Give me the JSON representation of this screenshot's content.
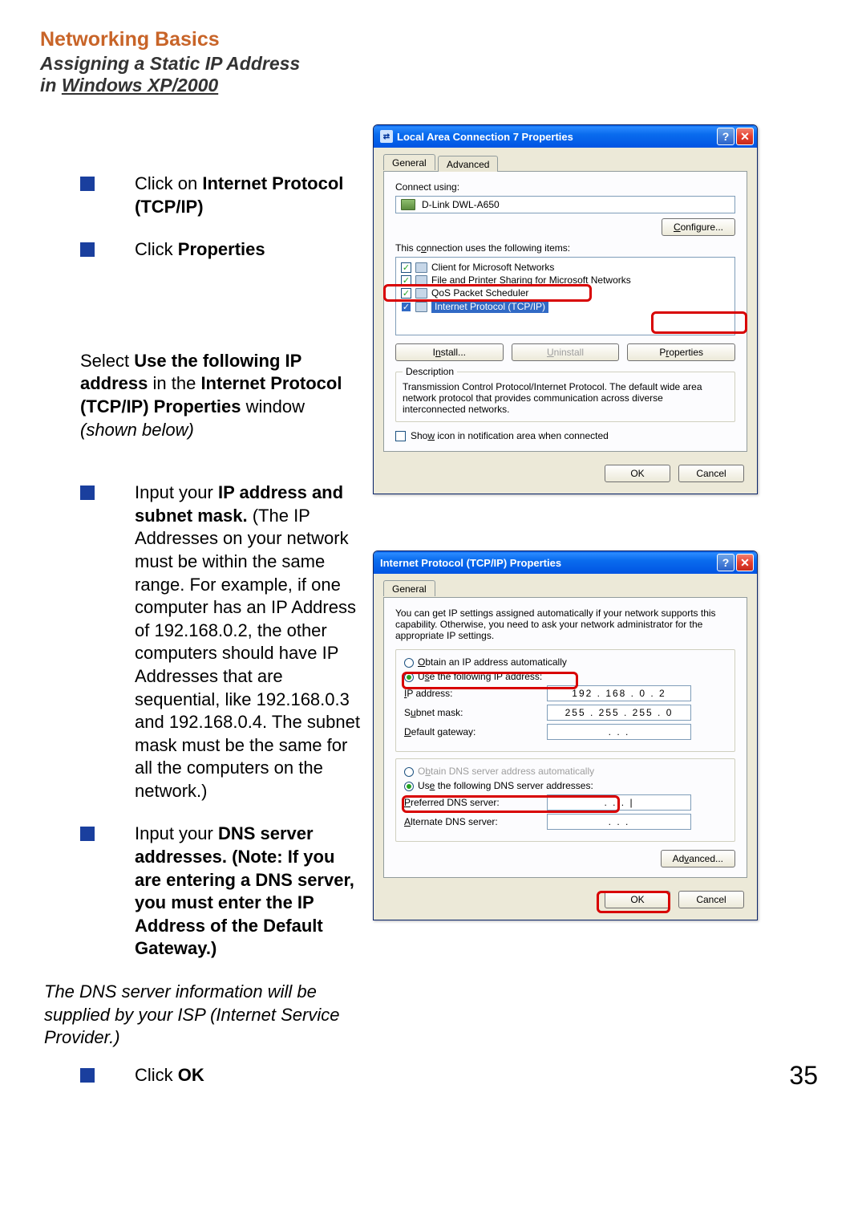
{
  "heading": "Networking Basics",
  "subtitle_line1": "Assigning a Static IP Address",
  "subtitle_line2_prefix": "in ",
  "subtitle_line2_u": "Windows XP/2000",
  "bullets": {
    "b1_pre": "Click on ",
    "b1_bold": "Internet Protocol (TCP/IP)",
    "b2_pre": "Click ",
    "b2_bold": "Properties",
    "select_text_pre": "Select ",
    "select_text_b1": "Use the following IP address",
    "select_text_mid": "  in the ",
    "select_text_b2": "Internet Protocol (TCP/IP) Properties",
    "select_text_post1": " window ",
    "select_text_post2": "(shown below)",
    "b3_pre": "Input your ",
    "b3_bold": "IP address and subnet mask.",
    "b3_rest": " (The IP Addresses on your network must be within the same range. For example, if one computer has an IP Address of 192.168.0.2, the other computers should have IP Addresses that are sequential, like 192.168.0.3 and 192.168.0.4.  The subnet mask must be the same for all the computers on the network.)",
    "b4_pre": "Input your ",
    "b4_bold": "DNS server addresses.  (Note:  If you are entering a DNS server, you must enter the IP Address of the Default Gateway.)",
    "dns_note": "The DNS server information will be supplied by your ISP (Internet Service Provider.)",
    "b5_pre": "Click ",
    "b5_bold": "OK"
  },
  "page_number": "35",
  "dialog1": {
    "title": "Local Area Connection 7 Properties",
    "tab_general": "General",
    "tab_advanced": "Advanced",
    "connect_using": "Connect using:",
    "device": "D-Link DWL-A650",
    "configure": "Configure...",
    "uses_items": "This connection uses the following items:",
    "items": [
      "Client for Microsoft Networks",
      "File and Printer Sharing for Microsoft Networks",
      "QoS Packet Scheduler",
      "Internet Protocol (TCP/IP)"
    ],
    "install": "Install...",
    "uninstall": "Uninstall",
    "properties": "Properties",
    "desc_legend": "Description",
    "desc_text": "Transmission Control Protocol/Internet Protocol. The default wide area network protocol that provides communication across diverse interconnected networks.",
    "show_icon": "Show icon in notification area when connected",
    "ok": "OK",
    "cancel": "Cancel"
  },
  "dialog2": {
    "title": "Internet Protocol (TCP/IP) Properties",
    "tab_general": "General",
    "intro": "You can get IP settings assigned automatically if your network supports this capability. Otherwise, you need to ask your network administrator for the appropriate IP settings.",
    "obtain_auto": "Obtain an IP address automatically",
    "use_following": "Use the following IP address:",
    "ip_label": "IP address:",
    "ip_value": "192 . 168 .  0  .  2",
    "subnet_label": "Subnet mask:",
    "subnet_value": "255 . 255 . 255 .  0",
    "gateway_label": "Default gateway:",
    "gateway_value": ".        .        .",
    "obtain_dns_auto": "Obtain DNS server address automatically",
    "use_dns": "Use the following DNS server addresses:",
    "pref_dns": "Preferred DNS server:",
    "pref_dns_value": ".        .        .  |",
    "alt_dns": "Alternate DNS server:",
    "alt_dns_value": ".        .        .",
    "advanced": "Advanced...",
    "ok": "OK",
    "cancel": "Cancel"
  }
}
